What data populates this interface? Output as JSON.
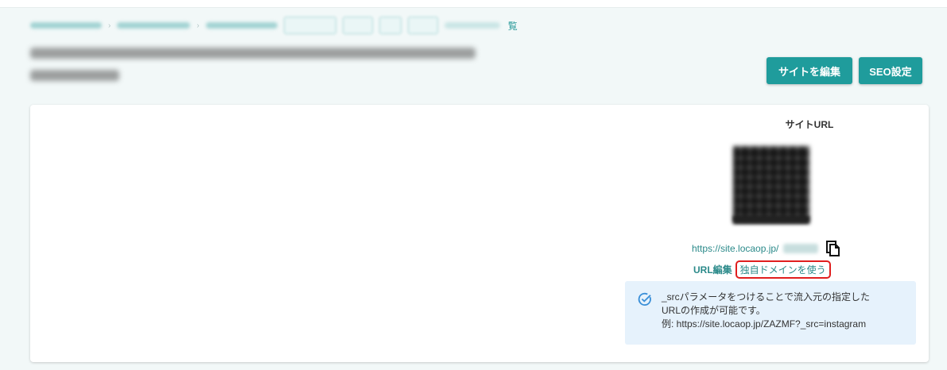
{
  "breadcrumb": {
    "last_fragment": "覧"
  },
  "header": {
    "edit_site_label": "サイトを編集",
    "seo_label": "SEO設定"
  },
  "site_url": {
    "heading": "サイトURL",
    "url_prefix": "https://site.locaop.jp/",
    "url_edit_label": "URL編集",
    "custom_domain_label": "独自ドメインを使う"
  },
  "info": {
    "line1": "_srcパラメータをつけることで流入元の指定した",
    "line2": "URLの作成が可能です。",
    "line3": "例: https://site.locaop.jp/ZAZMF?_src=instagram"
  },
  "colors": {
    "primary": "#1f9c9c",
    "link": "#2b8a8a",
    "highlight": "#e01e1e",
    "info_bg": "#e6f2fc"
  },
  "icons": [
    "copy-icon",
    "check-circle-icon"
  ]
}
